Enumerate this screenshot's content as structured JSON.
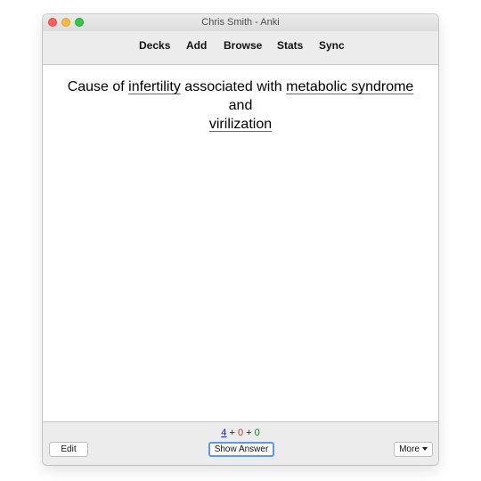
{
  "window": {
    "title": "Chris Smith - Anki"
  },
  "toolbar": {
    "items": [
      {
        "label": "Decks"
      },
      {
        "label": "Add"
      },
      {
        "label": "Browse"
      },
      {
        "label": "Stats"
      },
      {
        "label": "Sync"
      }
    ]
  },
  "card": {
    "question_parts": [
      {
        "text": "Cause of ",
        "misspelled": false
      },
      {
        "text": "infertility",
        "misspelled": true
      },
      {
        "text": " associated with ",
        "misspelled": false
      },
      {
        "text": "metabolic syndrome",
        "misspelled": true
      },
      {
        "text": " and ",
        "misspelled": false
      },
      {
        "text": "virilization",
        "misspelled": true
      }
    ]
  },
  "bottom": {
    "counts": {
      "new": "4",
      "learning": "0",
      "review": "0",
      "sep": "+"
    },
    "edit_label": "Edit",
    "show_answer_label": "Show Answer",
    "more_label": "More"
  },
  "colors": {
    "spellcheck_underline": "#e0315a",
    "new_count": "#1a1ad6",
    "learning_count": "#c0392b",
    "review_count": "#1f7a1f",
    "focus_ring": "#5b9ae8"
  },
  "icons": [
    "close-button-icon",
    "minimize-button-icon",
    "zoom-button-icon",
    "dropdown-caret-icon"
  ]
}
